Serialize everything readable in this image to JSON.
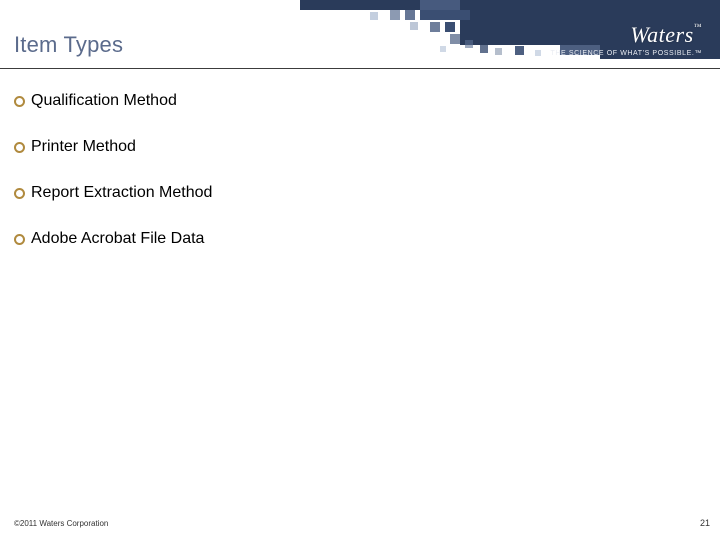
{
  "header": {
    "title": "Item Types",
    "logo_text": "Waters",
    "logo_tm": "™",
    "tagline": "THE SCIENCE OF WHAT'S POSSIBLE.™"
  },
  "items": [
    {
      "label": "Qualification Method"
    },
    {
      "label": "Printer Method"
    },
    {
      "label": "Report Extraction Method"
    },
    {
      "label": "Adobe Acrobat File Data"
    }
  ],
  "footer": {
    "copyright": "©2011 Waters Corporation",
    "page_number": "21"
  }
}
